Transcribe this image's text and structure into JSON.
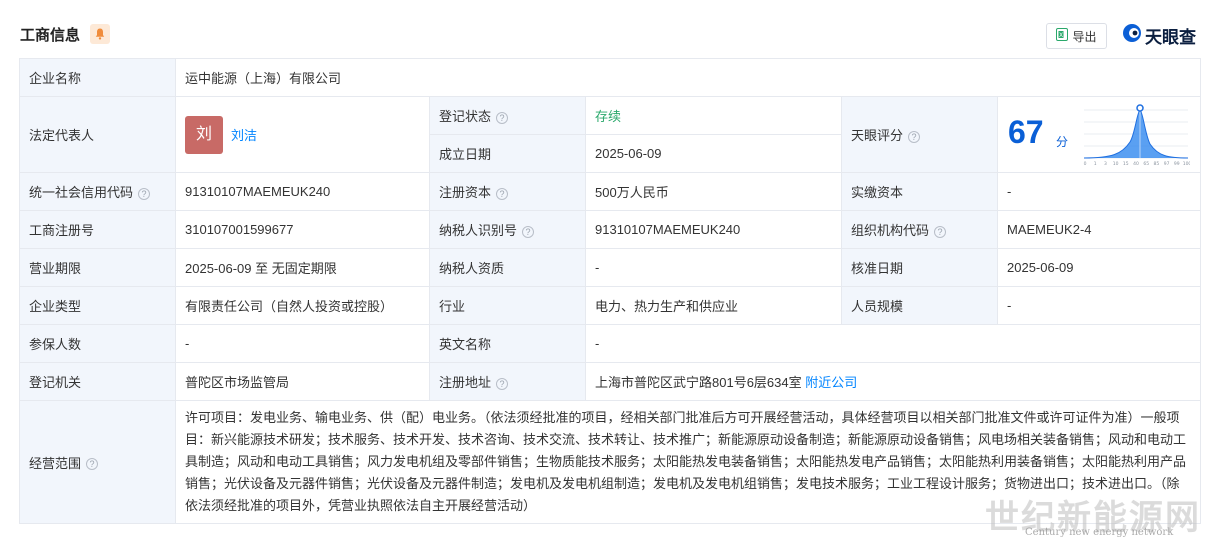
{
  "header": {
    "title": "工商信息",
    "export_label": "导出",
    "logo_text": "天眼查"
  },
  "company": {
    "name_label": "企业名称",
    "name_value": "运中能源（上海）有限公司",
    "rep_label": "法定代表人",
    "rep_avatar": "刘",
    "rep_name": "刘洁",
    "reg_status_label": "登记状态",
    "reg_status_value": "存续",
    "founded_label": "成立日期",
    "founded_value": "2025-06-09",
    "score_label": "天眼评分",
    "score_value": "67",
    "score_unit": "分",
    "credit_code_label": "统一社会信用代码",
    "credit_code_value": "91310107MAEMEUK240",
    "reg_capital_label": "注册资本",
    "reg_capital_value": "500万人民币",
    "paid_capital_label": "实缴资本",
    "paid_capital_value": "-",
    "biz_reg_no_label": "工商注册号",
    "biz_reg_no_value": "310107001599677",
    "taxpayer_id_label": "纳税人识别号",
    "taxpayer_id_value": "91310107MAEMEUK240",
    "org_code_label": "组织机构代码",
    "org_code_value": "MAEMEUK2-4",
    "term_label": "营业期限",
    "term_value": "2025-06-09 至 无固定期限",
    "taxpayer_qual_label": "纳税人资质",
    "taxpayer_qual_value": "-",
    "approval_date_label": "核准日期",
    "approval_date_value": "2025-06-09",
    "type_label": "企业类型",
    "type_value": "有限责任公司（自然人投资或控股）",
    "industry_label": "行业",
    "industry_value": "电力、热力生产和供应业",
    "staff_size_label": "人员规模",
    "staff_size_value": "-",
    "insured_label": "参保人数",
    "insured_value": "-",
    "english_name_label": "英文名称",
    "english_name_value": "-",
    "authority_label": "登记机关",
    "authority_value": "普陀区市场监管局",
    "address_label": "注册地址",
    "address_value": "上海市普陀区武宁路801号6层634室",
    "nearby_link": "附近公司",
    "scope_label": "经营范围",
    "scope_value": "许可项目：发电业务、输电业务、供（配）电业务。（依法须经批准的项目，经相关部门批准后方可开展经营活动，具体经营项目以相关部门批准文件或许可证件为准）一般项目：新兴能源技术研发；技术服务、技术开发、技术咨询、技术交流、技术转让、技术推广；新能源原动设备制造；新能源原动设备销售；风电场相关装备销售；风动和电动工具制造；风动和电动工具销售；风力发电机组及零部件销售；生物质能技术服务；太阳能热发电装备销售；太阳能热发电产品销售；太阳能热利用装备销售；太阳能热利用产品销售；光伏设备及元器件销售；光伏设备及元器件制造；发电机及发电机组制造；发电机及发电机组销售；发电技术服务；工业工程设计服务；货物进出口；技术进出口。（除依法须经批准的项目外，凭营业执照依法自主开展经营活动）"
  },
  "score_chart": {
    "x_ticks": [
      "0",
      "1",
      "3",
      "10",
      "15",
      "40",
      "65",
      "85",
      "97",
      "99",
      "100"
    ],
    "marker_value": 67
  },
  "watermark": {
    "main": "世纪新能源网",
    "sub": "Century new energy network"
  },
  "colors": {
    "label_bg": "#f2f6fc",
    "border": "#e6e9ef",
    "link": "#0084ff",
    "status_green": "#2aa86b",
    "score_blue": "#0a5fd6"
  }
}
